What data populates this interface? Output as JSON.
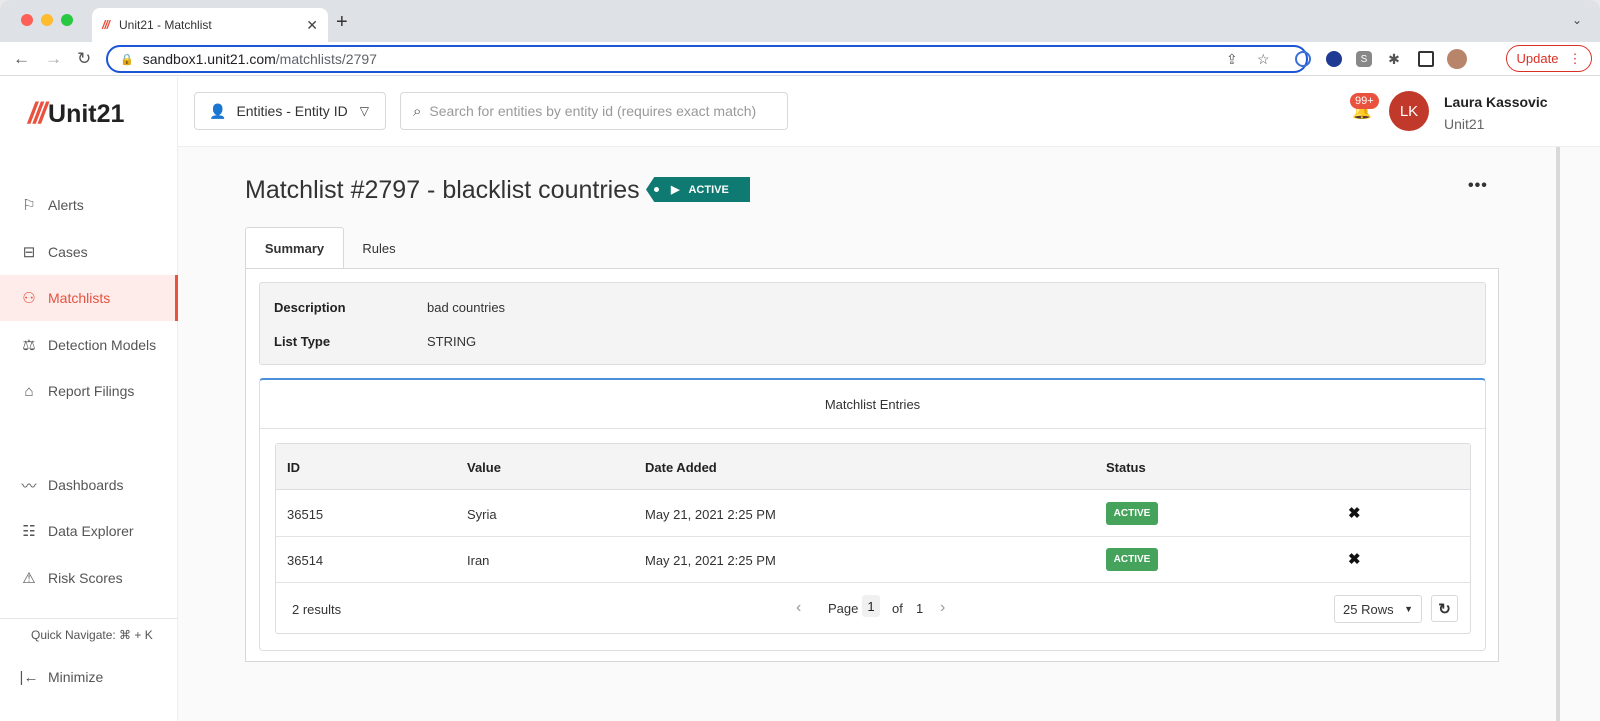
{
  "browser": {
    "tab_title": "Unit21 - Matchlist",
    "url_host": "sandbox1.unit21.com",
    "url_path": "/matchlists/2797",
    "update_label": "Update"
  },
  "sidebar": {
    "logo_text": "Unit21",
    "items": [
      {
        "label": "Alerts",
        "icon": "flag-icon"
      },
      {
        "label": "Cases",
        "icon": "briefcase-icon"
      },
      {
        "label": "Matchlists",
        "icon": "user-x-icon"
      },
      {
        "label": "Detection Models",
        "icon": "scale-icon"
      },
      {
        "label": "Report Filings",
        "icon": "bank-icon"
      },
      {
        "label": "Dashboards",
        "icon": "chart-line-icon"
      },
      {
        "label": "Data Explorer",
        "icon": "table-search-icon"
      },
      {
        "label": "Risk Scores",
        "icon": "warning-icon"
      }
    ],
    "quick_navigate": "Quick Navigate: ⌘ + K",
    "minimize_label": "Minimize"
  },
  "topbar": {
    "entity_select": "Entities - Entity ID",
    "search_placeholder": "Search for entities by entity id (requires exact match)",
    "notification_badge": "99+",
    "avatar_initials": "LK",
    "user_name": "Laura Kassovic",
    "user_org": "Unit21"
  },
  "page": {
    "title": "Matchlist #2797 - blacklist countries",
    "status": "ACTIVE",
    "tabs": [
      {
        "label": "Summary"
      },
      {
        "label": "Rules"
      }
    ]
  },
  "summary": {
    "description_label": "Description",
    "description_value": "bad countries",
    "list_type_label": "List Type",
    "list_type_value": "STRING"
  },
  "entries": {
    "heading": "Matchlist Entries",
    "columns": [
      "ID",
      "Value",
      "Date Added",
      "Status"
    ],
    "rows": [
      {
        "id": "36515",
        "value": "Syria",
        "date_added": "May 21, 2021 2:25 PM",
        "status": "ACTIVE"
      },
      {
        "id": "36514",
        "value": "Iran",
        "date_added": "May 21, 2021 2:25 PM",
        "status": "ACTIVE"
      }
    ],
    "results_text": "2 results",
    "page_label": "Page",
    "current_page": "1",
    "of_label": "of",
    "total_pages": "1",
    "rows_per_page": "25 Rows"
  },
  "colors": {
    "brand_red": "#e8523f",
    "status_teal": "#0e7a72",
    "active_green": "#46a35b",
    "focus_blue": "#1a56d6"
  }
}
